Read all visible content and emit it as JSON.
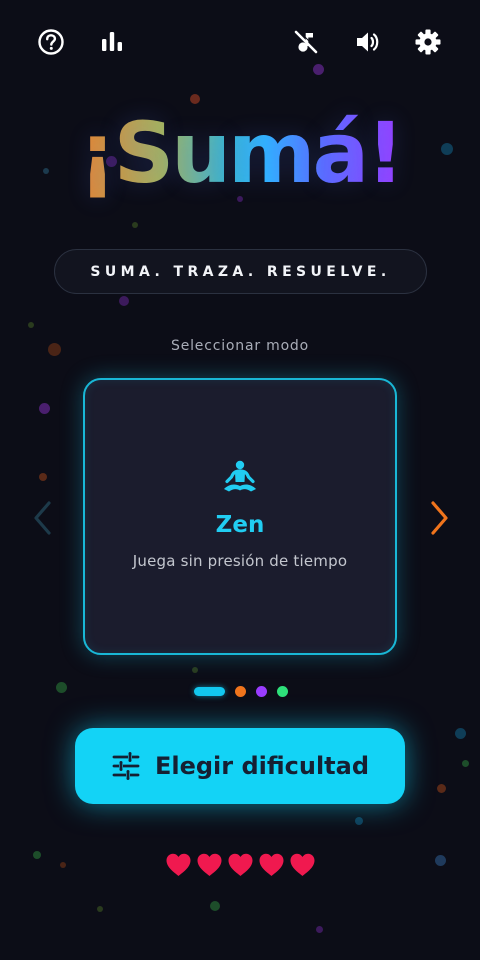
{
  "header": {
    "icons": [
      "help-icon",
      "stats-icon",
      "music-off-icon",
      "volume-icon",
      "settings-icon"
    ]
  },
  "logo": {
    "text": "¡Sumá!"
  },
  "tagline": "SUMA. TRAZA. RESUELVE.",
  "mode_selector": {
    "label": "Seleccionar modo",
    "selected_index": 0,
    "modes": [
      {
        "name": "Zen",
        "description": "Juega sin presión de tiempo",
        "icon": "meditation-icon",
        "color": "#21cdf2"
      }
    ],
    "page_dots": [
      {
        "color": "#12c7ef",
        "active": true
      },
      {
        "color": "#f0741c",
        "active": false
      },
      {
        "color": "#9a3cff",
        "active": false
      },
      {
        "color": "#2ee07a",
        "active": false
      }
    ]
  },
  "difficulty_button": {
    "label": "Elegir dificultad",
    "icon": "sliders-icon"
  },
  "lives": {
    "count": 5,
    "icon": "heart-icon",
    "color": "#f0194f"
  },
  "colors": {
    "background": "#0c0d17",
    "accent": "#13d3f6",
    "arrow_next": "#f0741c",
    "arrow_prev": "#1d3a4a"
  }
}
